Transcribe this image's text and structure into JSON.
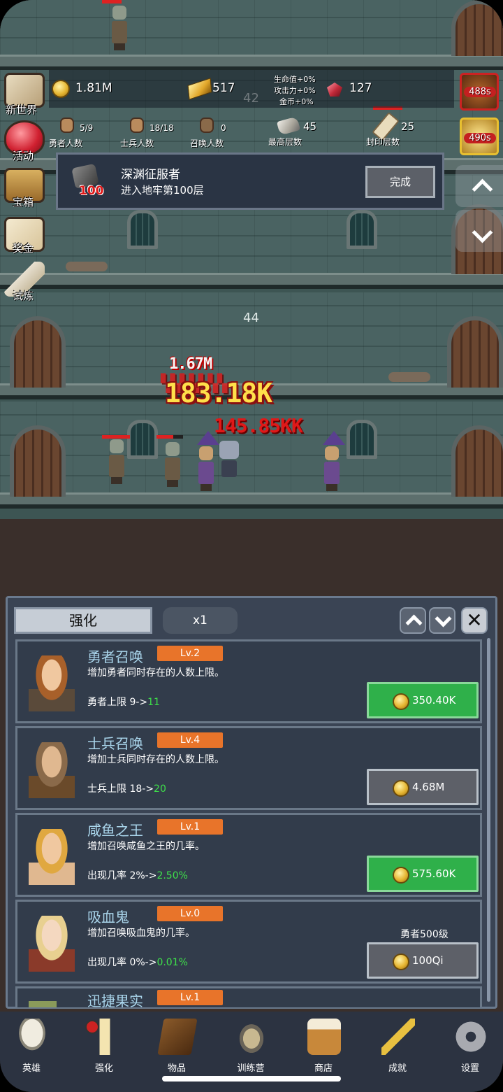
{
  "hud": {
    "coins": "1.81M",
    "gold_bars": "517",
    "bonus_hp": "生命值+0%",
    "bonus_atk": "攻击力+0%",
    "bonus_gold": "金币+0%",
    "gems": "127",
    "hero_count": "5/9",
    "hero_label": "勇者人数",
    "soldier_count": "18/18",
    "soldier_label": "士兵人数",
    "summon_count": "0",
    "summon_label": "召唤人数",
    "max_floor": "45",
    "max_floor_label": "最高层数",
    "sealed_floor": "25",
    "sealed_floor_label": "封印层数",
    "timer1": "488s",
    "timer2": "490s"
  },
  "side_menu": [
    {
      "label": "新世界",
      "icon": "map-icon"
    },
    {
      "label": "活动",
      "icon": "heart-icon"
    },
    {
      "label": "宝箱",
      "icon": "chest-icon"
    },
    {
      "label": "奖金",
      "icon": "envelope-icon"
    },
    {
      "label": "试炼",
      "icon": "feather-icon"
    }
  ],
  "quest": {
    "title": "深渊征服者",
    "desc": "进入地牢第100层",
    "badge": "100",
    "button": "完成"
  },
  "dungeon": {
    "floor_top": "42",
    "floor_mid": "44",
    "damage": [
      "1.67M",
      "183.18K",
      "145.85KK"
    ]
  },
  "panel": {
    "tab": "强化",
    "multiplier": "x1",
    "cards": [
      {
        "name": "勇者召唤",
        "level": "Lv.2",
        "desc": "增加勇者同时存在的人数上限。",
        "stat_prefix": "勇者上限 9->",
        "stat_new": "11",
        "price": "350.40K",
        "req": ""
      },
      {
        "name": "士兵召唤",
        "level": "Lv.4",
        "desc": "增加士兵同时存在的人数上限。",
        "stat_prefix": "士兵上限 18->",
        "stat_new": "20",
        "price": "4.68M",
        "req": ""
      },
      {
        "name": "咸鱼之王",
        "level": "Lv.1",
        "desc": "增加召唤咸鱼之王的几率。",
        "stat_prefix": "出现几率 2%->",
        "stat_new": "2.50%",
        "price": "575.60K",
        "req": ""
      },
      {
        "name": "吸血鬼",
        "level": "Lv.0",
        "desc": "增加召唤吸血鬼的几率。",
        "stat_prefix": "出现几率 0%->",
        "stat_new": "0.01%",
        "price": "100Qi",
        "req": "勇者500级"
      },
      {
        "name": "迅捷果实",
        "level": "Lv.1",
        "desc": "",
        "stat_prefix": "",
        "stat_new": "",
        "price": "",
        "req": ""
      }
    ]
  },
  "nav": [
    {
      "label": "英雄",
      "icon": "skull-icon"
    },
    {
      "label": "强化",
      "icon": "candle-icon"
    },
    {
      "label": "物品",
      "icon": "book-icon"
    },
    {
      "label": "训练营",
      "icon": "lantern-icon"
    },
    {
      "label": "商店",
      "icon": "mug-icon"
    },
    {
      "label": "成就",
      "icon": "key-icon"
    },
    {
      "label": "设置",
      "icon": "gear-icon"
    }
  ],
  "colors": {
    "buy_green": "#2fb04a",
    "buy_gray": "#5d6068",
    "level_orange": "#e8742a",
    "stat_new_green": "#3ee04a"
  }
}
